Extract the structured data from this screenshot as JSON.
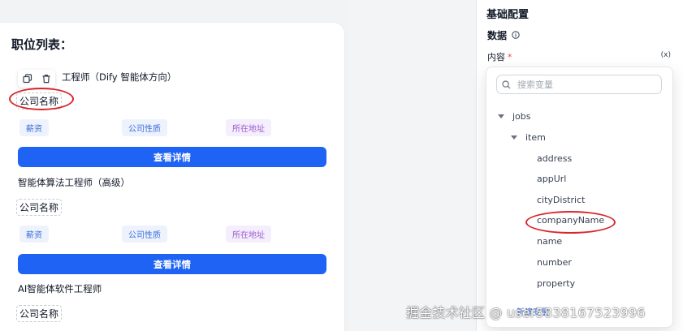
{
  "canvas": {
    "list_title": "职位列表：",
    "jobs": [
      {
        "title": "工程师（Dify 智能体方向）",
        "company": "公司名称",
        "tags": [
          "薪资",
          "公司性质",
          "所在地址"
        ],
        "button": "查看详情"
      },
      {
        "title": "智能体算法工程师（高级）",
        "company": "公司名称",
        "tags": [
          "薪资",
          "公司性质",
          "所在地址"
        ],
        "button": "查看详情"
      },
      {
        "title": "AI智能体软件工程师",
        "company": "公司名称"
      }
    ]
  },
  "panel": {
    "heading": "基础配置",
    "data_label": "数据",
    "content_label": "内容",
    "required_mark": "*",
    "fx_label": "(x)"
  },
  "dropdown": {
    "search_placeholder": "搜索变量",
    "tree": {
      "root": "jobs",
      "child": "item",
      "fields": [
        "address",
        "appUrl",
        "cityDistrict",
        "companyName",
        "name",
        "number",
        "property"
      ]
    },
    "new_variable": "新建变量"
  },
  "watermark": "掘金技术社区 @ user5838167523996",
  "colors": {
    "primary": "#1f63f5",
    "annotation_red": "#d9262c",
    "tag_blue": "#3b6fd8",
    "tag_purple": "#9b5cd0"
  }
}
